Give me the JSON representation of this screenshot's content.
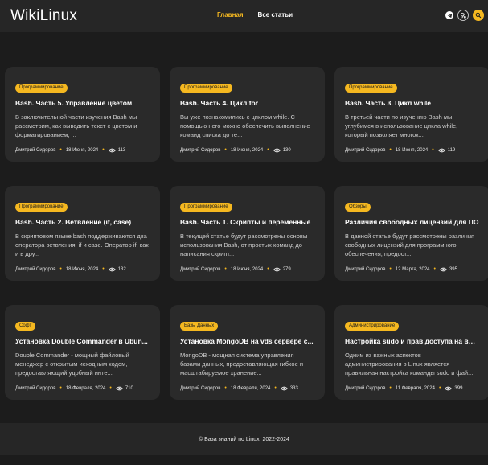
{
  "header": {
    "logo": "WikiLinux",
    "nav": [
      {
        "label": "Главная",
        "active": true
      },
      {
        "label": "Все статьи",
        "active": false
      }
    ],
    "icons": [
      "telegram-icon",
      "theme-toggle-icon",
      "search-icon"
    ]
  },
  "cards": [
    {
      "badge": "Программирование",
      "title": "Bash. Часть 5. Управление цветом",
      "desc": "В заключительной части изучения Bash мы рассмотрим, как выводить текст с цветом и форматированием, ...",
      "author": "Дмитрий Сидоров",
      "date": "18 Июня, 2024",
      "views": "113"
    },
    {
      "badge": "Программирование",
      "title": "Bash. Часть 4. Цикл for",
      "desc": "Вы уже познакомились с циклом while. С помощью него можно обеспечить выполнение команд списка до те...",
      "author": "Дмитрий Сидоров",
      "date": "18 Июня, 2024",
      "views": "130"
    },
    {
      "badge": "Программирование",
      "title": "Bash. Часть 3. Цикл while",
      "desc": "В третьей части по изучению Bash мы углубимся в использование цикла while, который позволяет многок...",
      "author": "Дмитрий Сидоров",
      "date": "18 Июня, 2024",
      "views": "119"
    },
    {
      "badge": "Программирование",
      "title": "Bash. Часть 2. Ветвление (if, case)",
      "desc": "В скриптовом языке bash поддерживаются два оператора ветвления: if и case. Оператор if, как и в дру...",
      "author": "Дмитрий Сидоров",
      "date": "18 Июня, 2024",
      "views": "132"
    },
    {
      "badge": "Программирование",
      "title": "Bash. Часть 1. Скрипты и переменные",
      "desc": "В текущей статье будут рассмотрены основы использования Bash, от простых команд до написания скрипт...",
      "author": "Дмитрий Сидоров",
      "date": "18 Июня, 2024",
      "views": "279"
    },
    {
      "badge": "Обзоры",
      "title": "Различия свободных лицензий для ПО",
      "desc": "В данной статье будут рассмотрены различия свободных лицензий для программного обеспечения, предост...",
      "author": "Дмитрий Сидоров",
      "date": "12 Марта, 2024",
      "views": "395"
    },
    {
      "badge": "Софт",
      "title": "Установка Double Commander в Ubun...",
      "desc": "Double Commander - мощный файловый менеджер с открытым исходным кодом, предоставляющий удобный инте...",
      "author": "Дмитрий Сидоров",
      "date": "18 Февраля, 2024",
      "views": "710"
    },
    {
      "badge": "Базы Данных",
      "title": "Установка MongoDB на vds сервере с...",
      "desc": "MongoDB - мощная система управления базами данных, предоставляющая гибкое и масштабируемое хранение...",
      "author": "Дмитрий Сидоров",
      "date": "18 Февраля, 2024",
      "views": "333"
    },
    {
      "badge": "Администрирование",
      "title": "Настройка sudo и прав доступа на вы...",
      "desc": "Одним из важных аспектов администрирования в Linux является правильная настройка команды sudo и фай...",
      "author": "Дмитрий Сидоров",
      "date": "11 Февраля, 2024",
      "views": "399"
    }
  ],
  "footer": {
    "text": "© База знаний по Linux, 2022-2024"
  },
  "colors": {
    "accent": "#f5b820",
    "background": "#1c1c1c",
    "card": "#2a2a2a",
    "header": "#262626"
  }
}
